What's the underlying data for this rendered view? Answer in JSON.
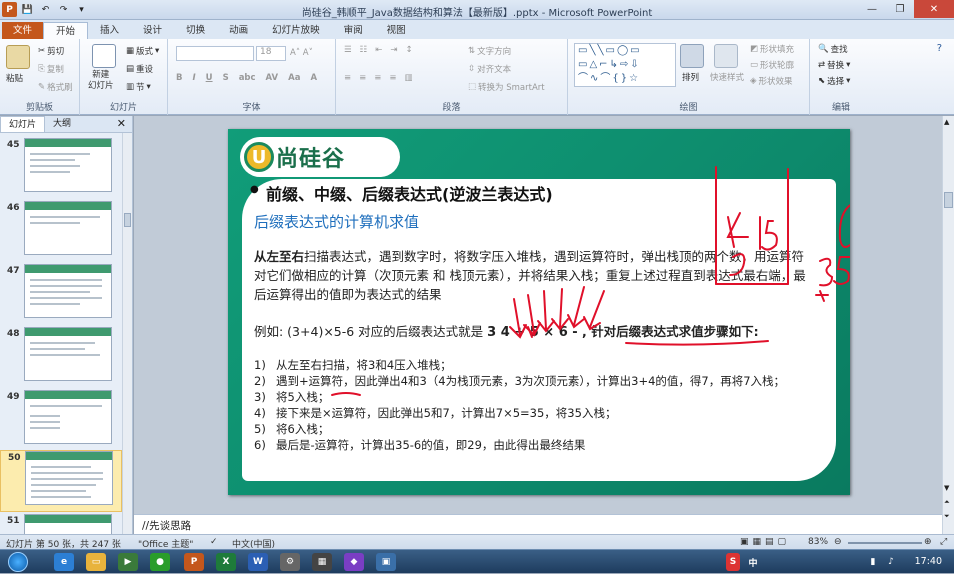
{
  "window": {
    "title": "尚硅谷_韩顺平_Java数据结构和算法【最新版】.pptx - Microsoft PowerPoint"
  },
  "tabs": [
    "文件",
    "开始",
    "插入",
    "设计",
    "切换",
    "动画",
    "幻灯片放映",
    "审阅",
    "视图"
  ],
  "ribbon": {
    "clipboard": {
      "label": "剪贴板",
      "paste": "粘贴",
      "cut": "剪切",
      "copy": "复制",
      "format_painter": "格式刷"
    },
    "slides": {
      "label": "幻灯片",
      "new_slide": "新建\n幻灯片",
      "layout": "版式",
      "reset": "重设",
      "section": "节"
    },
    "font": {
      "label": "字体",
      "size": "18"
    },
    "paragraph": {
      "label": "段落",
      "text_direction": "文字方向",
      "align_text": "对齐文本",
      "smartart": "转换为 SmartArt"
    },
    "drawing": {
      "label": "绘图",
      "arrange": "排列",
      "quick_styles": "快速样式",
      "fill": "形状填充",
      "outline": "形状轮廓",
      "effects": "形状效果"
    },
    "editing": {
      "label": "编辑",
      "find": "查找",
      "replace": "替换",
      "select": "选择"
    }
  },
  "panel": {
    "tabs": [
      "幻灯片",
      "大纲"
    ],
    "slide_numbers": [
      "45",
      "46",
      "47",
      "48",
      "49",
      "50",
      "51"
    ]
  },
  "slide": {
    "logo_text": "尚硅谷",
    "title": "前缀、中缀、后缀表达式(逆波兰表达式)",
    "subtitle": "后缀表达式的计算机求值",
    "para_lead": "从左至右",
    "para_rest": "扫描表达式，遇到数字时，将数字压入堆栈，遇到运算符时，弹出栈顶的两个数，用运算符对它们做相应的计算（次顶元素 和 栈顶元素），并将结果入栈；重复上述过程直到表达式最右端，最后运算得出的值即为表达式的结果",
    "example_prefix": "例如: (3+4)×5-6 对应的后缀表达式就是 ",
    "example_expr": "3 4 + 5 × 6 -",
    "example_suffix": " , 针对后缀表达式求值步骤如下:",
    "steps": [
      {
        "n": "1)",
        "text": "从左至右扫描，将3和4压入堆栈；"
      },
      {
        "n": "2)",
        "text": "遇到+运算符，因此弹出4和3（4为栈顶元素，3为次顶元素），计算出3+4的值，得7，再将7入栈；"
      },
      {
        "n": "3)",
        "text": "将5入栈；"
      },
      {
        "n": "4)",
        "text": "接下来是×运算符，因此弹出5和7，计算出7×5=35，将35入栈；"
      },
      {
        "n": "5)",
        "text": "将6入栈；"
      },
      {
        "n": "6)",
        "text": "最后是-运算符，计算出35-6的值，即29，由此得出最终结果"
      }
    ]
  },
  "notes": "//先谈思路",
  "status": {
    "slide_info": "幻灯片 第 50 张，共 247 张",
    "theme": "\"Office 主题\"",
    "language": "中文(中国)",
    "zoom": "83%"
  },
  "taskbar": {
    "time": "17:40"
  },
  "colors": {
    "accent": "#c4571c",
    "slide_green": "#0d8a6c",
    "subtitle_blue": "#1f6fbd",
    "ink": "#e0102a"
  }
}
